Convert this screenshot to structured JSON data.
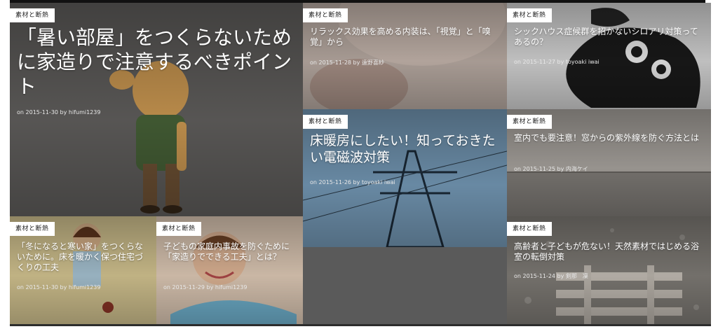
{
  "tiles": [
    {
      "tag": "素材と断熱",
      "title": "「暑い部屋」をつくらないために家造りで注意するべきポイント",
      "date": "on 2015-11-30 by hifumi1239"
    },
    {
      "tag": "素材と断熱",
      "title": "リラックス効果を高める内装は、「視覚」と「嗅覚」から",
      "date": "on 2015-11-28 by 遠野喜紗"
    },
    {
      "tag": "素材と断熱",
      "title": "シックハウス症候群を招かないシロアリ対策ってあるの？",
      "date": "on 2015-11-27 by toyoaki iwai"
    },
    {
      "tag": "素材と断熱",
      "title": "床暖房にしたい！知っておきたい電磁波対策",
      "date": "on 2015-11-26 by toyoaki iwai"
    },
    {
      "tag": "素材と断熱",
      "title": "室内でも要注意！窓からの紫外線を防ぐ方法とは",
      "date": "on 2015-11-25 by 内海ケイ"
    },
    {
      "tag": "素材と断熱",
      "title": "「冬になると寒い家」をつくらないために。床を暖かく保つ住宅づくりの工夫",
      "date": "on 2015-11-30 by hifumi1239"
    },
    {
      "tag": "素材と断熱",
      "title": "子どもの家庭内事故を防ぐために「家造りでできる工夫」とは？",
      "date": "on 2015-11-29 by hifumi1239"
    },
    {
      "tag": "素材と断熱",
      "title": "高齢者と子どもが危ない！天然素材ではじめる浴室の転倒対策",
      "date": "on 2015-11-24 by 剣那　凜"
    }
  ]
}
